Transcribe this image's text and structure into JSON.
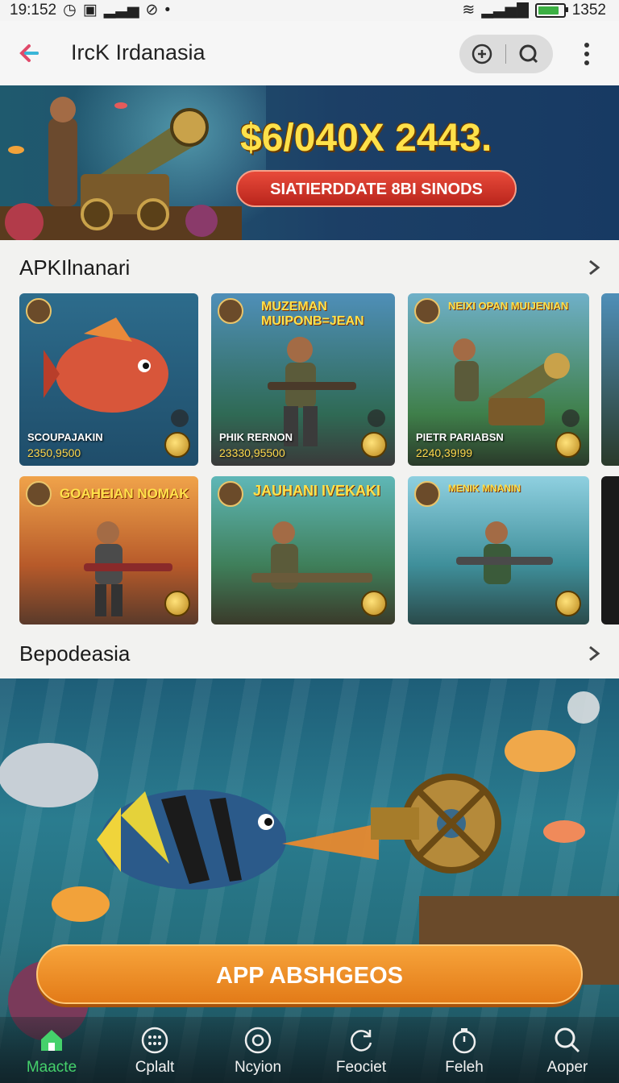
{
  "status_bar": {
    "time": "19:152",
    "battery_text": "1352",
    "battery_level": 0.9
  },
  "app_bar": {
    "title": "IrcK Irdanasia"
  },
  "banner": {
    "amount": "$6/040X 2443.",
    "button_label": "SIATIERDDATE 8BI SINODS"
  },
  "section1": {
    "title": "APKIlnanari",
    "cards": [
      {
        "name": "SCOUPAJAKIN",
        "value": "2350,9500",
        "tag": "",
        "art_title": ""
      },
      {
        "name": "PHIK RERNON",
        "value": "23330,95500",
        "tag": "",
        "art_title": "MUZEMAN MUIPONB=JEAN"
      },
      {
        "name": "PIETR PARIABSN",
        "value": "2240,39!99",
        "tag": "",
        "art_title": "NEIXI OPAN MUIJENIAN"
      },
      {
        "name": "",
        "value": "",
        "tag": "",
        "art_title": "GOAHEIAN NOMAK"
      },
      {
        "name": "",
        "value": "",
        "tag": "",
        "art_title": "JAUHANI IVEKAKI"
      },
      {
        "name": "",
        "value": "",
        "tag": "",
        "art_title": "MENIK MNANIN"
      }
    ]
  },
  "section2": {
    "title": "Bepodeasia"
  },
  "cta": {
    "label": "APP ABSHGEOS"
  },
  "bottom_nav": [
    {
      "label": "Maacte",
      "icon": "home-icon",
      "active": true
    },
    {
      "label": "Cplalt",
      "icon": "grid-dots-icon",
      "active": false
    },
    {
      "label": "Ncyion",
      "icon": "target-icon",
      "active": false
    },
    {
      "label": "Feociet",
      "icon": "refresh-icon",
      "active": false
    },
    {
      "label": "Feleh",
      "icon": "timer-icon",
      "active": false
    },
    {
      "label": "Aoper",
      "icon": "search-icon",
      "active": false
    }
  ],
  "colors": {
    "accent": "#e37b18",
    "nav_active": "#45d16b",
    "banner_amount": "#ffe14a"
  }
}
